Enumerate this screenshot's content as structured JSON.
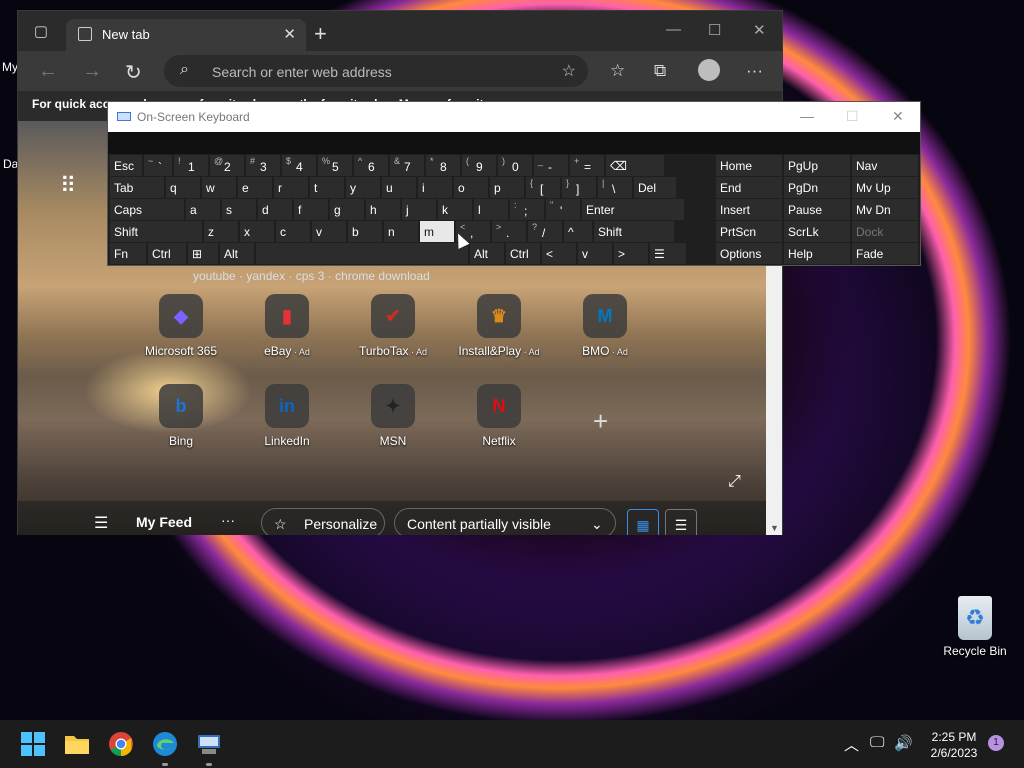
{
  "desktop": {
    "frag_my": "My",
    "frag_da": "Da",
    "recycle_bin": {
      "label": "Recycle Bin",
      "icon": "recycle-icon"
    }
  },
  "browser": {
    "tab_title": "New tab",
    "address_placeholder": "Search or enter web address",
    "favorites_msg": "For quick access, place your favorites here on the favorites bar. Manage favorites now",
    "ntp": {
      "search_hints": "youtube · yandex · cps 3 · chrome download",
      "tiles": [
        {
          "label": "Microsoft 365",
          "ad": "",
          "icon": "microsoft365-icon",
          "glyph": "◆",
          "color": "#7b61ff"
        },
        {
          "label": "eBay",
          "ad": "Ad",
          "icon": "ebay-icon",
          "glyph": "▮",
          "color": "#e53238"
        },
        {
          "label": "TurboTax",
          "ad": "Ad",
          "icon": "turbotax-icon",
          "glyph": "✔",
          "color": "#d52b1e"
        },
        {
          "label": "Install&Play",
          "ad": "Ad",
          "icon": "installplay-icon",
          "glyph": "♛",
          "color": "#d98a1a"
        },
        {
          "label": "BMO",
          "ad": "Ad",
          "icon": "bmo-icon",
          "glyph": "M",
          "color": "#0079c1"
        },
        {
          "label": "Bing",
          "ad": "",
          "icon": "bing-icon",
          "glyph": "b",
          "color": "#1e73d8"
        },
        {
          "label": "LinkedIn",
          "ad": "",
          "icon": "linkedin-icon",
          "glyph": "in",
          "color": "#0a66c2"
        },
        {
          "label": "MSN",
          "ad": "",
          "icon": "msn-icon",
          "glyph": "✦",
          "color": "#222222"
        },
        {
          "label": "Netflix",
          "ad": "",
          "icon": "netflix-icon",
          "glyph": "N",
          "color": "#e50914"
        }
      ],
      "feed": {
        "my_feed": "My Feed",
        "personalize": "Personalize",
        "content_visibility": "Content partially visible"
      }
    }
  },
  "osk": {
    "title": "On-Screen Keyboard",
    "rows": [
      [
        {
          "main": "Esc",
          "sub": "",
          "w": 34
        },
        {
          "main": "`",
          "sub": "~",
          "w": 30
        },
        {
          "main": "1",
          "sub": "!",
          "w": 36
        },
        {
          "main": "2",
          "sub": "@",
          "w": 36
        },
        {
          "main": "3",
          "sub": "#",
          "w": 36
        },
        {
          "main": "4",
          "sub": "$",
          "w": 36
        },
        {
          "main": "5",
          "sub": "%",
          "w": 36
        },
        {
          "main": "6",
          "sub": "^",
          "w": 36
        },
        {
          "main": "7",
          "sub": "&",
          "w": 36
        },
        {
          "main": "8",
          "sub": "*",
          "w": 36
        },
        {
          "main": "9",
          "sub": "(",
          "w": 36
        },
        {
          "main": "0",
          "sub": ")",
          "w": 36
        },
        {
          "main": "-",
          "sub": "_",
          "w": 36
        },
        {
          "main": "=",
          "sub": "+",
          "w": 36
        },
        {
          "main": "⌫",
          "sub": "",
          "w": 60
        }
      ],
      [
        {
          "main": "Tab",
          "sub": "",
          "w": 56
        },
        {
          "main": "q",
          "sub": "",
          "w": 36
        },
        {
          "main": "w",
          "sub": "",
          "w": 36
        },
        {
          "main": "e",
          "sub": "",
          "w": 36
        },
        {
          "main": "r",
          "sub": "",
          "w": 36
        },
        {
          "main": "t",
          "sub": "",
          "w": 36
        },
        {
          "main": "y",
          "sub": "",
          "w": 36
        },
        {
          "main": "u",
          "sub": "",
          "w": 36
        },
        {
          "main": "i",
          "sub": "",
          "w": 36
        },
        {
          "main": "o",
          "sub": "",
          "w": 36
        },
        {
          "main": "p",
          "sub": "",
          "w": 36
        },
        {
          "main": "[",
          "sub": "{",
          "w": 36
        },
        {
          "main": "]",
          "sub": "}",
          "w": 36
        },
        {
          "main": "\\",
          "sub": "|",
          "w": 36
        },
        {
          "main": "Del",
          "sub": "",
          "w": 44
        }
      ],
      [
        {
          "main": "Caps",
          "sub": "",
          "w": 76
        },
        {
          "main": "a",
          "sub": "",
          "w": 36
        },
        {
          "main": "s",
          "sub": "",
          "w": 36
        },
        {
          "main": "d",
          "sub": "",
          "w": 36
        },
        {
          "main": "f",
          "sub": "",
          "w": 36
        },
        {
          "main": "g",
          "sub": "",
          "w": 36
        },
        {
          "main": "h",
          "sub": "",
          "w": 36
        },
        {
          "main": "j",
          "sub": "",
          "w": 36
        },
        {
          "main": "k",
          "sub": "",
          "w": 36
        },
        {
          "main": "l",
          "sub": "",
          "w": 36
        },
        {
          "main": ";",
          "sub": ":",
          "w": 36
        },
        {
          "main": "'",
          "sub": "\"",
          "w": 36
        },
        {
          "main": "Enter",
          "sub": "",
          "w": 104
        }
      ],
      [
        {
          "main": "Shift",
          "sub": "",
          "w": 94
        },
        {
          "main": "z",
          "sub": "",
          "w": 36
        },
        {
          "main": "x",
          "sub": "",
          "w": 36
        },
        {
          "main": "c",
          "sub": "",
          "w": 36
        },
        {
          "main": "v",
          "sub": "",
          "w": 36
        },
        {
          "main": "b",
          "sub": "",
          "w": 36
        },
        {
          "main": "n",
          "sub": "",
          "w": 36
        },
        {
          "main": "m",
          "sub": "",
          "w": 36,
          "pressed": true
        },
        {
          "main": ",",
          "sub": "<",
          "w": 36
        },
        {
          "main": ".",
          "sub": ">",
          "w": 36
        },
        {
          "main": "/",
          "sub": "?",
          "w": 36
        },
        {
          "main": "^",
          "sub": "",
          "w": 30
        },
        {
          "main": "Shift",
          "sub": "",
          "w": 82
        }
      ],
      [
        {
          "main": "Fn",
          "sub": "",
          "w": 38
        },
        {
          "main": "Ctrl",
          "sub": "",
          "w": 40
        },
        {
          "main": "⊞",
          "sub": "",
          "w": 32
        },
        {
          "main": "Alt",
          "sub": "",
          "w": 36
        },
        {
          "main": "",
          "sub": "",
          "w": 214
        },
        {
          "main": "Alt",
          "sub": "",
          "w": 36
        },
        {
          "main": "Ctrl",
          "sub": "",
          "w": 36
        },
        {
          "main": "<",
          "sub": "",
          "w": 36
        },
        {
          "main": "v",
          "sub": "",
          "w": 36
        },
        {
          "main": ">",
          "sub": "",
          "w": 36
        },
        {
          "main": "☰",
          "sub": "",
          "w": 38
        }
      ]
    ],
    "side_rows": [
      [
        {
          "main": "Home"
        },
        {
          "main": "PgUp"
        },
        {
          "main": "Nav"
        }
      ],
      [
        {
          "main": "End"
        },
        {
          "main": "PgDn"
        },
        {
          "main": "Mv Up"
        }
      ],
      [
        {
          "main": "Insert"
        },
        {
          "main": "Pause"
        },
        {
          "main": "Mv Dn"
        }
      ],
      [
        {
          "main": "PrtScn"
        },
        {
          "main": "ScrLk"
        },
        {
          "main": "Dock",
          "disabled": true
        }
      ],
      [
        {
          "main": "Options"
        },
        {
          "main": "Help"
        },
        {
          "main": "Fade"
        }
      ]
    ]
  },
  "taskbar": {
    "apps": [
      {
        "name": "start-button",
        "icon": "windows-logo-icon"
      },
      {
        "name": "file-explorer-button",
        "icon": "folder-icon"
      },
      {
        "name": "chrome-button",
        "icon": "chrome-icon"
      },
      {
        "name": "edge-button",
        "icon": "edge-icon"
      },
      {
        "name": "on-screen-keyboard-button",
        "icon": "keyboard-icon"
      }
    ],
    "time": "2:25 PM",
    "date": "2/6/2023",
    "notifications": "1"
  }
}
